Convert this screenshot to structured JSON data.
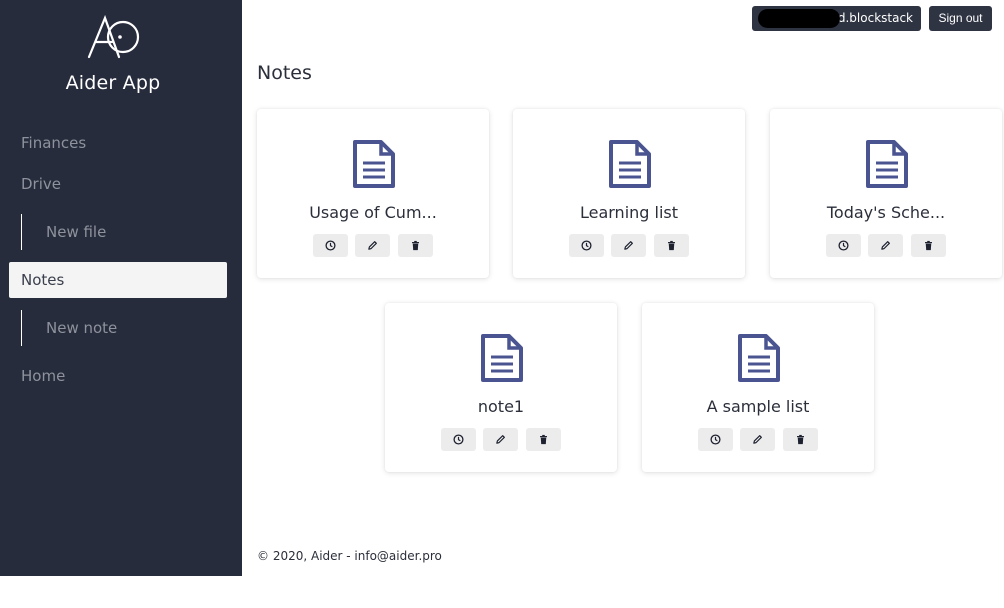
{
  "app": {
    "name": "Aider App",
    "logo_icon": "aider-logo-icon"
  },
  "sidebar": {
    "items": [
      {
        "label": "Finances"
      },
      {
        "label": "Drive"
      },
      {
        "label": "New file"
      },
      {
        "label": "Notes"
      },
      {
        "label": "New note"
      },
      {
        "label": "Home"
      }
    ]
  },
  "header": {
    "user_suffix": ".id.blockstack",
    "signout_label": "Sign out"
  },
  "main": {
    "title": "Notes",
    "notes": [
      {
        "title": "Usage of Cum..."
      },
      {
        "title": "Learning list"
      },
      {
        "title": "Today's Sche..."
      },
      {
        "title": "note1"
      },
      {
        "title": "A sample list"
      }
    ],
    "actions": [
      {
        "icon": "clock-icon"
      },
      {
        "icon": "pencil-icon"
      },
      {
        "icon": "trash-icon"
      }
    ]
  },
  "footer": {
    "text": "© 2020, Aider - info@aider.pro"
  },
  "colors": {
    "sidebar_bg": "#272c3d",
    "accent_icon": "#4a5490",
    "button_dark": "#2f3443"
  }
}
